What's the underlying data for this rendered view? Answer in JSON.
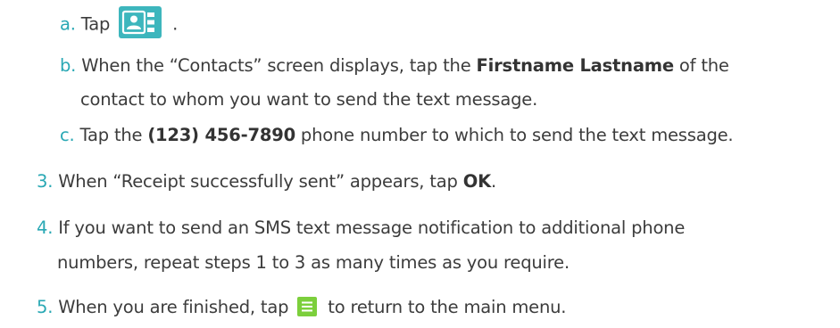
{
  "colors": {
    "step_number": "#29a8b4",
    "contacts_icon_bg": "#3db6bd",
    "menu_icon_bg": "#7ccf3c"
  },
  "steps": {
    "s2a": {
      "num": "a.",
      "pre": "Tap",
      "post": ".",
      "icon": "contacts-icon"
    },
    "s2b": {
      "num": "b.",
      "pre": "When the “Contacts” screen displays, tap the ",
      "bold": "Firstname Lastname",
      "post": " of the",
      "line2": "contact to whom you want to send the text message."
    },
    "s2c": {
      "num": "c.",
      "pre": "Tap the ",
      "bold": "(123) 456-7890",
      "post": " phone number to which to send the text message."
    },
    "s3": {
      "num": "3.",
      "pre": "When “Receipt successfully sent” appears, tap ",
      "bold": "OK",
      "post": "."
    },
    "s4": {
      "num": "4.",
      "line1": "If you want to send an SMS text message notification to additional phone",
      "line2": "numbers, repeat steps 1 to 3 as many times as you require."
    },
    "s5": {
      "num": "5.",
      "pre": "When you are finished, tap ",
      "post": " to return to the main menu.",
      "icon": "menu-icon"
    }
  }
}
